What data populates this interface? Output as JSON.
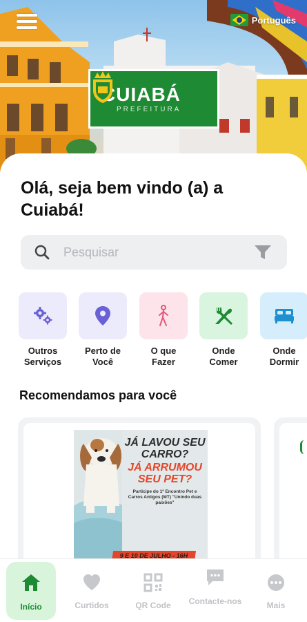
{
  "header": {
    "language": "Português",
    "logo_title": "CUIABÁ",
    "logo_subtitle": "PREFEITURA",
    "brand_color": "#1f8a34"
  },
  "main": {
    "greeting": "Olá, seja bem vindo (a) a Cuiabá!",
    "search": {
      "placeholder": "Pesquisar"
    },
    "categories": [
      {
        "label": "Outros Serviços",
        "icon": "gears-icon",
        "bg": "#ecebfb",
        "color": "#6a61d6"
      },
      {
        "label": "Perto de Você",
        "icon": "location-pin-icon",
        "bg": "#ecebfb",
        "color": "#6a61d6"
      },
      {
        "label": "O que Fazer",
        "icon": "walking-person-icon",
        "bg": "#fde3ea",
        "color": "#e2587a"
      },
      {
        "label": "Onde Comer",
        "icon": "fork-knife-icon",
        "bg": "#d9f5e0",
        "color": "#1f8a34"
      },
      {
        "label": "Onde Dormir",
        "icon": "bed-icon",
        "bg": "#d6eefb",
        "color": "#1e8fd0"
      }
    ],
    "recommend_title": "Recomendamos para você",
    "recommend_card": {
      "headline_1": "JÁ LAVOU SEU CARRO?",
      "headline_2": "JÁ ARRUMOU SEU PET?",
      "details": "Participe do 1º Encontro Pet e Carros Antigos (MT) \"Unindo duas paixões\"",
      "date": "9 E 10 DE JULHO - 16H"
    }
  },
  "bottom_nav": [
    {
      "label": "Início",
      "icon": "home-icon",
      "active": true
    },
    {
      "label": "Curtidos",
      "icon": "heart-icon",
      "active": false
    },
    {
      "label": "QR Code",
      "icon": "qr-code-icon",
      "active": false
    },
    {
      "label": "Contacte-nos",
      "icon": "chat-icon",
      "active": false
    },
    {
      "label": "Mais",
      "icon": "more-icon",
      "active": false
    }
  ]
}
